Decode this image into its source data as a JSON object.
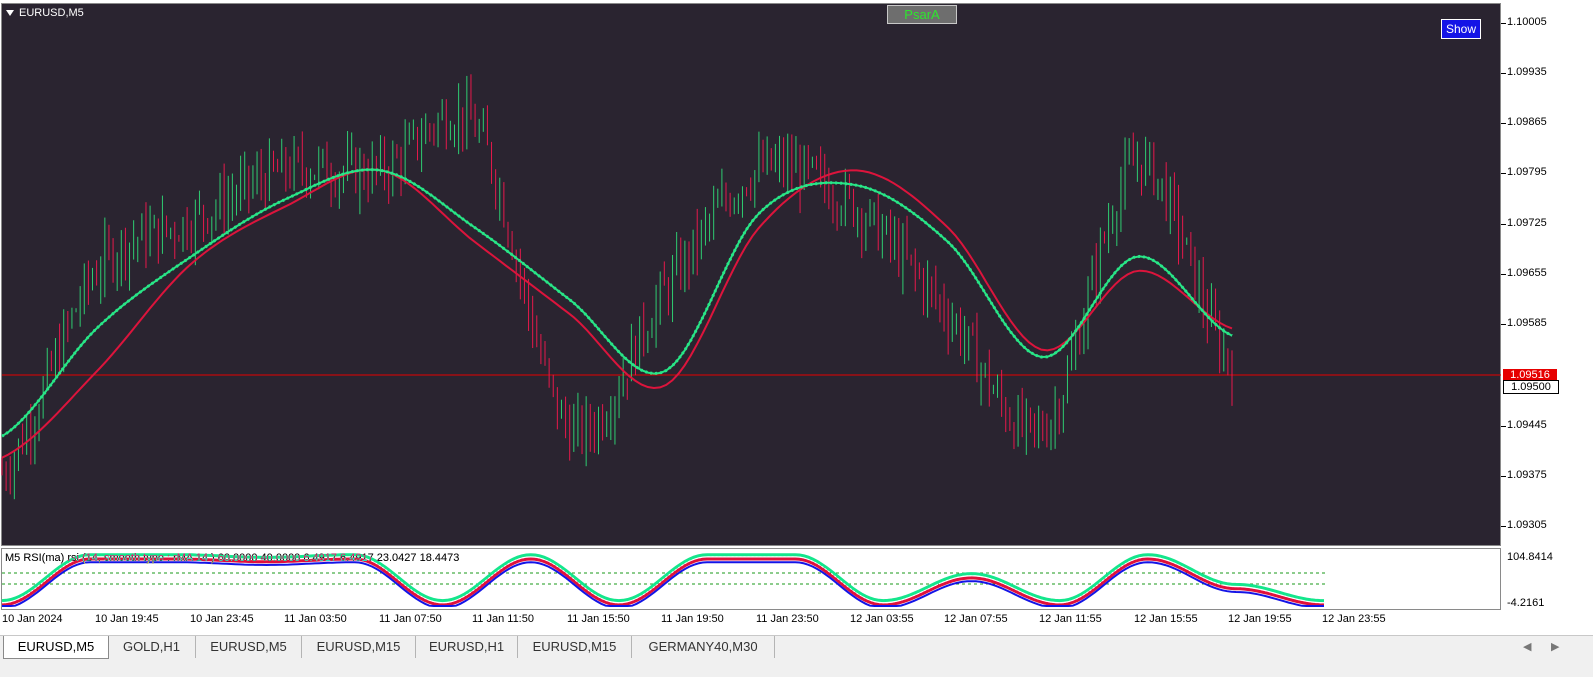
{
  "window": {
    "symbol_title": "EURUSD,M5",
    "indicator_button": "PsarA",
    "show_button": "Show"
  },
  "price_axis": {
    "ticks": [
      "1.10005",
      "1.09935",
      "1.09865",
      "1.09795",
      "1.09725",
      "1.09655",
      "1.09585",
      "1.09445",
      "1.09375",
      "1.09305"
    ],
    "ask_label": "1.09516",
    "bid_label": "1.09500",
    "ask_color": "#e60000",
    "bid_color": "#ffffff"
  },
  "subwindow": {
    "label": "M5 RSI(ma) rsi (14, smooth type : rMA  14 ) 60.0000 40.0000 6.4917 6.4917 23.0427 18.4473",
    "axis_top": "104.8414",
    "axis_bottom": "-4.2161"
  },
  "time_axis": [
    "10 Jan 2024",
    "10 Jan 19:45",
    "10 Jan 23:45",
    "11 Jan 03:50",
    "11 Jan 07:50",
    "11 Jan 11:50",
    "11 Jan 15:50",
    "11 Jan 19:50",
    "11 Jan 23:50",
    "12 Jan 03:55",
    "12 Jan 07:55",
    "12 Jan 11:55",
    "12 Jan 15:55",
    "12 Jan 19:55",
    "12 Jan 23:55"
  ],
  "tabs": [
    "EURUSD,M5",
    "GOLD,H1",
    "EURUSD,M5",
    "EURUSD,M15",
    "EURUSD,H1",
    "EURUSD,M15",
    "GERMANY40,M30"
  ],
  "active_tab": 0,
  "colors": {
    "background": "#2a2430",
    "bull_candle": "#2ecc71",
    "bear_candle": "#e6194b",
    "ma_up": "#28e687",
    "ma_down": "#dc143c",
    "rsi_up": "#14e68c",
    "rsi_down": "#e0103c",
    "rsi_signal": "#1414e6"
  },
  "chart_data": {
    "type": "line",
    "title": "EURUSD,M5",
    "ylim": [
      1.0927,
      1.1003
    ],
    "x": [
      "10 Jan 2024",
      "10 Jan 19:45",
      "10 Jan 23:45",
      "11 Jan 03:50",
      "11 Jan 07:50",
      "11 Jan 11:50",
      "11 Jan 15:50",
      "11 Jan 19:50",
      "11 Jan 23:50",
      "12 Jan 03:55",
      "12 Jan 07:55",
      "12 Jan 11:55",
      "12 Jan 15:55",
      "12 Jan 19:55",
      "12 Jan 23:55"
    ],
    "series": [
      {
        "values": [
          1.0938,
          1.0966,
          1.0973,
          1.098,
          1.098,
          1.0986,
          1.0944,
          1.0963,
          1.098,
          1.0975,
          1.096,
          1.0944,
          1.0981,
          1.0953,
          null
        ]
      },
      {
        "values": [
          1.094,
          1.0952,
          1.0967,
          1.0975,
          1.098,
          1.097,
          1.096,
          1.095,
          1.0972,
          1.098,
          1.0972,
          1.0955,
          1.0966,
          1.0958,
          null
        ]
      },
      {
        "values": [
          1.0943,
          1.0958,
          1.0968,
          1.0976,
          1.098,
          1.0972,
          1.0962,
          1.0952,
          1.0974,
          1.0978,
          1.097,
          1.0954,
          1.0968,
          1.0957,
          null
        ]
      }
    ]
  }
}
